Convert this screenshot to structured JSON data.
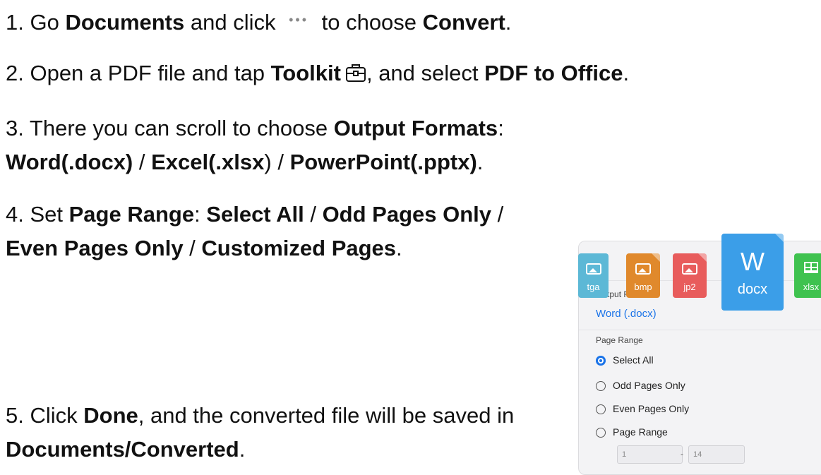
{
  "steps": {
    "s1": {
      "t1": "1. Go ",
      "b1": "Documents",
      "t2": " and click ",
      "t3": " to choose ",
      "b2": "Convert",
      "t4": "."
    },
    "s2": {
      "t1": "2. Open a PDF file and tap ",
      "b1": "Toolkit",
      "t2": ", and select ",
      "b2": "PDF to Office",
      "t3": "."
    },
    "s3": {
      "t1": "3. There you can scroll to choose ",
      "b1": "Output Formats",
      "t2": ": ",
      "b2": "Word(.docx)",
      "t3": " / ",
      "b3": "Excel(.xlsx",
      "t4": ") / ",
      "b4": "PowerPoint(.pptx)",
      "t5": "."
    },
    "s4": {
      "t1": "4. Set ",
      "b1": "Page Range",
      "t2": ": ",
      "b2": "Select All",
      "t3": " / ",
      "b3": "Odd Pages Only",
      "t4": " / ",
      "b4": "Even Pages Only",
      "t5": " / ",
      "b5": "Customized Pages",
      "t6": "."
    },
    "s5": {
      "t1": "5. Click ",
      "b1": "Done",
      "t2": ", and the converted file will be saved in ",
      "b2": "Documents/Converted",
      "t3": "."
    }
  },
  "icons": {
    "more": "more-dots-icon",
    "toolkit": "toolkit-icon"
  },
  "panel": {
    "back": "<",
    "output_formats_label": "Output Formats",
    "output_formats_value": "Word (.docx)",
    "files": [
      {
        "ext": "tga",
        "color": "#5cb8d6"
      },
      {
        "ext": "bmp",
        "color": "#e0892c"
      },
      {
        "ext": "jp2",
        "color": "#e85c5c"
      },
      {
        "ext": "docx",
        "letter": "W",
        "color": "#3b9ee8"
      },
      {
        "ext": "xlsx",
        "color": "#3fc24f"
      }
    ],
    "page_range_label": "Page Range",
    "options": [
      "Select All",
      "Odd Pages Only",
      "Even Pages Only",
      "Page Range"
    ],
    "selected_option": "Select All",
    "range_from": "1",
    "range_to": "14"
  },
  "colors": {
    "accent": "#1a73e8"
  }
}
